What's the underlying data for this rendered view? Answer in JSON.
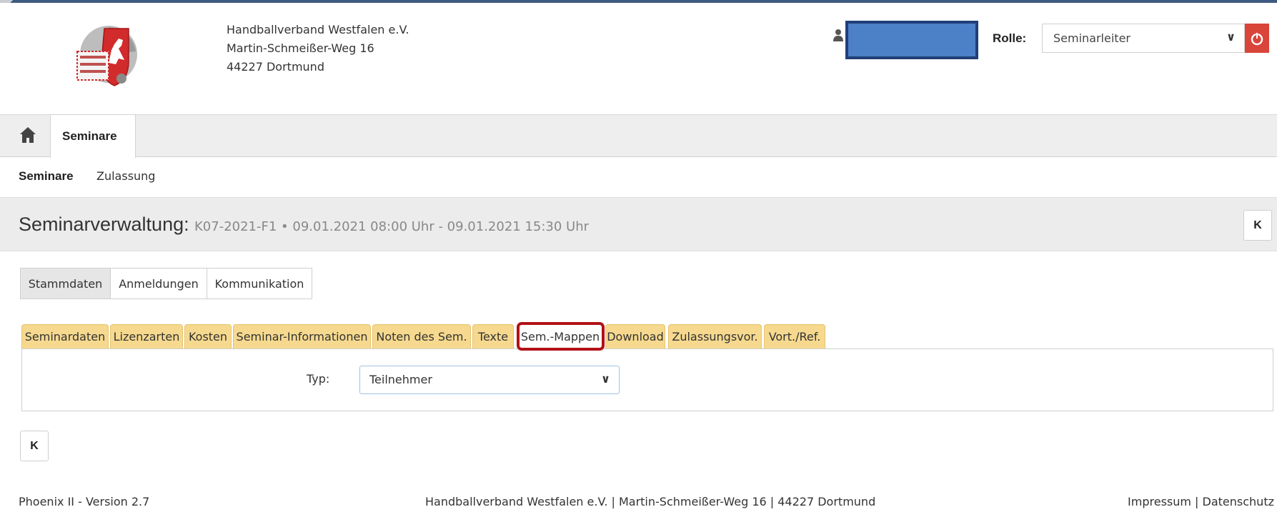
{
  "header": {
    "org_name": "Handballverband Westfalen e.V.",
    "org_street": "Martin-Schmeißer-Weg 16",
    "org_city": "44227 Dortmund",
    "role_label": "Rolle:",
    "role_value": "Seminarleiter",
    "user_name_redacted": ""
  },
  "nav": {
    "home_icon": "home-icon",
    "tab_label": "Seminare"
  },
  "subnav": [
    "Seminare",
    "Zulassung"
  ],
  "title": {
    "main": "Seminarverwaltung:",
    "sub": "K07-2021-F1 • 09.01.2021 08:00 Uhr - 09.01.2021 15:30 Uhr",
    "first_button": "K"
  },
  "sections": [
    "Stammdaten",
    "Anmeldungen",
    "Kommunikation"
  ],
  "active_section": "Stammdaten",
  "tabs": [
    "Seminardaten",
    "Lizenzarten",
    "Kosten",
    "Seminar-Informationen",
    "Noten des Sem.",
    "Texte",
    "Sem.-Mappen",
    "Download",
    "Zulassungsvor.",
    "Vort./Ref."
  ],
  "active_tab": "Sem.-Mappen",
  "form": {
    "typ_label": "Typ:",
    "typ_value": "Teilnehmer"
  },
  "bottom_first_button": "K",
  "footer": {
    "left": "Phoenix II - Version 2.7",
    "center": "Handballverband Westfalen e.V. | Martin-Schmeißer-Weg 16 | 44227 Dortmund",
    "right": "Impressum | Datenschutz"
  },
  "colors": {
    "tab_yellow": "#f6d98e",
    "highlight_red": "#b11016",
    "power_red": "#d9453a",
    "redaction_blue": "#4c80c7"
  }
}
